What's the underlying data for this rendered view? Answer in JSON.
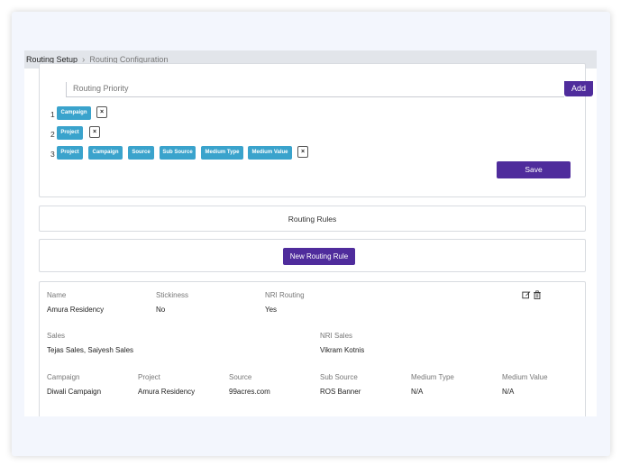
{
  "breadcrumb": {
    "first": "Routing Setup",
    "second": "Routing Configuration"
  },
  "priority": {
    "placeholder": "Routing Priority",
    "add_label": "Add"
  },
  "priority_rows": [
    {
      "num": "1",
      "tags": [
        "Campaign"
      ]
    },
    {
      "num": "2",
      "tags": [
        "Project"
      ]
    },
    {
      "num": "3",
      "tags": [
        "Project",
        "Campaign",
        "Source",
        "Sub Source",
        "Medium Type",
        "Medium Value"
      ]
    }
  ],
  "remove_glyph": "×",
  "save_label": "Save",
  "rules": {
    "title": "Routing Rules",
    "new_label": "New Routing Rule"
  },
  "rule": {
    "name_label": "Name",
    "name": "Amura Residency",
    "stickiness_label": "Stickiness",
    "stickiness": "No",
    "nri_routing_label": "NRI Routing",
    "nri_routing": "Yes",
    "sales_label": "Sales",
    "sales": "Tejas Sales, Saiyesh Sales",
    "nri_sales_label": "NRI Sales",
    "nri_sales": "Vikram Kotnis",
    "campaign_label": "Campaign",
    "campaign": "Diwali Campaign",
    "project_label": "Project",
    "project": "Amura Residency",
    "source_label": "Source",
    "source": "99acres.com",
    "sub_source_label": "Sub Source",
    "sub_source": "ROS Banner",
    "medium_type_label": "Medium Type",
    "medium_type": "N/A",
    "medium_value_label": "Medium Value",
    "medium_value": "N/A"
  },
  "icons": {
    "edit": "edit-icon",
    "delete": "trash-icon"
  },
  "colors": {
    "accent": "#4f2c9c",
    "tag": "#3aa3cc",
    "frame_bg": "#f3f6fd",
    "crumb_bg": "#e2e5ea"
  }
}
